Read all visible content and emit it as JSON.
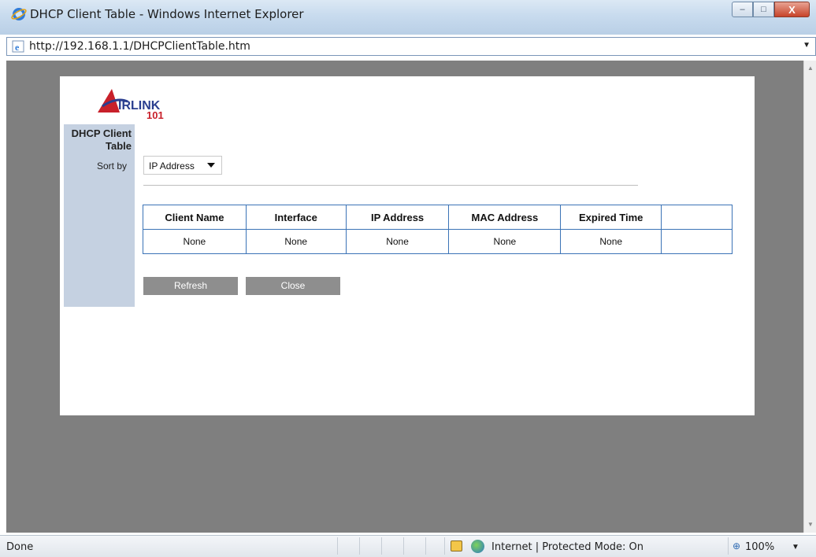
{
  "window": {
    "title": "DHCP Client Table - Windows Internet Explorer",
    "minimize_glyph": "–",
    "maximize_glyph": "□",
    "close_glyph": "X"
  },
  "address_bar": {
    "url": "http://192.168.1.1/DHCPClientTable.htm",
    "dropdown_glyph": "▼"
  },
  "logo": {
    "brand_main": "IRLINK",
    "brand_sub": "101",
    "icon": "airlink-logo"
  },
  "sidebar": {
    "title_line1": "DHCP Client",
    "title_line2": "Table",
    "sort_label": "Sort by"
  },
  "sort_select": {
    "selected": "IP Address",
    "options": [
      "IP Address"
    ]
  },
  "table": {
    "headers": [
      "Client Name",
      "Interface",
      "IP Address",
      "MAC Address",
      "Expired Time",
      ""
    ],
    "rows": [
      [
        "None",
        "None",
        "None",
        "None",
        "None",
        ""
      ]
    ]
  },
  "buttons": {
    "refresh": "Refresh",
    "close": "Close"
  },
  "status_bar": {
    "status": "Done",
    "zone": "Internet | Protected Mode: On",
    "zoom": "100%",
    "zoom_dropdown_glyph": "▼"
  },
  "colors": {
    "accent_blue": "#3b73b6",
    "sidebar_bg": "#c5d1e1",
    "viewport_bg": "#7f7f7f",
    "button_bg": "#8e8e8e"
  }
}
